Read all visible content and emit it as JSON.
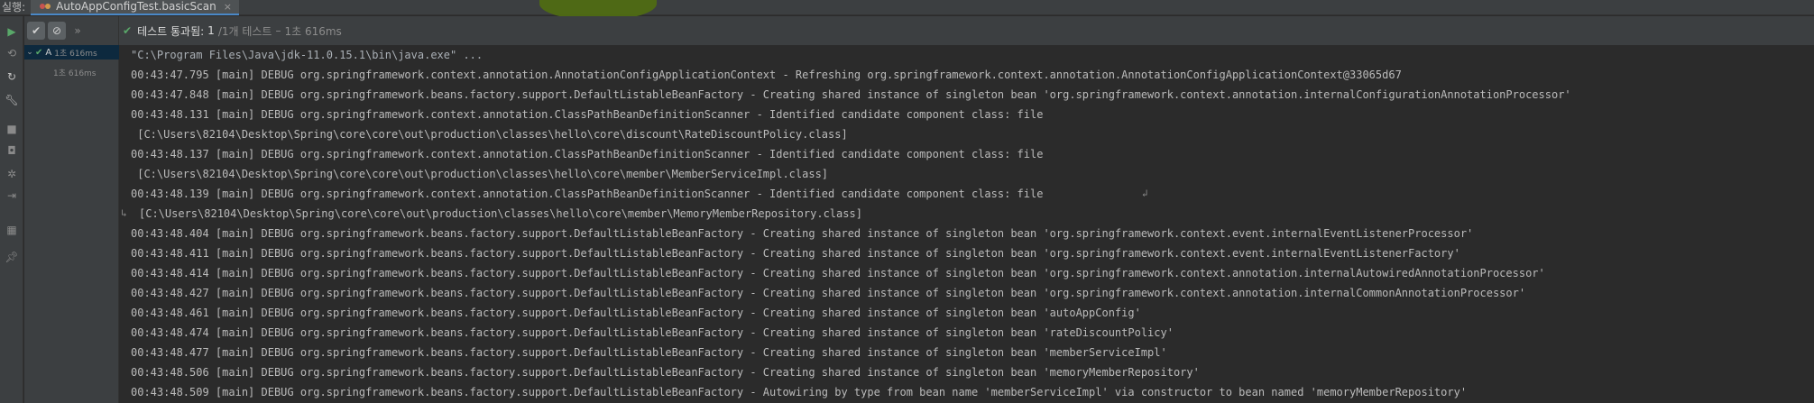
{
  "tabbar": {
    "run_label": "실행:",
    "tab_title": "AutoAppConfigTest.basicScan",
    "close_glyph": "×"
  },
  "tree": {
    "root": {
      "label": "A",
      "time": "1초 616ms"
    },
    "child": {
      "time": "1초 616ms"
    }
  },
  "status": {
    "passed_label": "테스트 통과됨:",
    "passed_count": "1",
    "total": "/1개 테스트",
    "separator": "–",
    "duration": "1초 616ms"
  },
  "console": {
    "lines": [
      "\"C:\\Program Files\\Java\\jdk-11.0.15.1\\bin\\java.exe\" ...",
      "00:43:47.795 [main] DEBUG org.springframework.context.annotation.AnnotationConfigApplicationContext - Refreshing org.springframework.context.annotation.AnnotationConfigApplicationContext@33065d67",
      "00:43:47.848 [main] DEBUG org.springframework.beans.factory.support.DefaultListableBeanFactory - Creating shared instance of singleton bean 'org.springframework.context.annotation.internalConfigurationAnnotationProcessor'",
      "00:43:48.131 [main] DEBUG org.springframework.context.annotation.ClassPathBeanDefinitionScanner - Identified candidate component class: file",
      " [C:\\Users\\82104\\Desktop\\Spring\\core\\core\\out\\production\\classes\\hello\\core\\discount\\RateDiscountPolicy.class]",
      "00:43:48.137 [main] DEBUG org.springframework.context.annotation.ClassPathBeanDefinitionScanner - Identified candidate component class: file",
      " [C:\\Users\\82104\\Desktop\\Spring\\core\\core\\out\\production\\classes\\hello\\core\\member\\MemberServiceImpl.class]",
      "00:43:48.139 [main] DEBUG org.springframework.context.annotation.ClassPathBeanDefinitionScanner - Identified candidate component class: file",
      "[C:\\Users\\82104\\Desktop\\Spring\\core\\core\\out\\production\\classes\\hello\\core\\member\\MemoryMemberRepository.class]",
      "00:43:48.404 [main] DEBUG org.springframework.beans.factory.support.DefaultListableBeanFactory - Creating shared instance of singleton bean 'org.springframework.context.event.internalEventListenerProcessor'",
      "00:43:48.411 [main] DEBUG org.springframework.beans.factory.support.DefaultListableBeanFactory - Creating shared instance of singleton bean 'org.springframework.context.event.internalEventListenerFactory'",
      "00:43:48.414 [main] DEBUG org.springframework.beans.factory.support.DefaultListableBeanFactory - Creating shared instance of singleton bean 'org.springframework.context.annotation.internalAutowiredAnnotationProcessor'",
      "00:43:48.427 [main] DEBUG org.springframework.beans.factory.support.DefaultListableBeanFactory - Creating shared instance of singleton bean 'org.springframework.context.annotation.internalCommonAnnotationProcessor'",
      "00:43:48.461 [main] DEBUG org.springframework.beans.factory.support.DefaultListableBeanFactory - Creating shared instance of singleton bean 'autoAppConfig'",
      "00:43:48.474 [main] DEBUG org.springframework.beans.factory.support.DefaultListableBeanFactory - Creating shared instance of singleton bean 'rateDiscountPolicy'",
      "00:43:48.477 [main] DEBUG org.springframework.beans.factory.support.DefaultListableBeanFactory - Creating shared instance of singleton bean 'memberServiceImpl'",
      "00:43:48.506 [main] DEBUG org.springframework.beans.factory.support.DefaultListableBeanFactory - Creating shared instance of singleton bean 'memoryMemberRepository'",
      "00:43:48.509 [main] DEBUG org.springframework.beans.factory.support.DefaultListableBeanFactory - Autowiring by type from bean name 'memberServiceImpl' via constructor to bean named 'memoryMemberRepository'"
    ]
  },
  "icons": {
    "run": "play-icon",
    "passed": "check-icon",
    "stop": "stop-icon"
  }
}
